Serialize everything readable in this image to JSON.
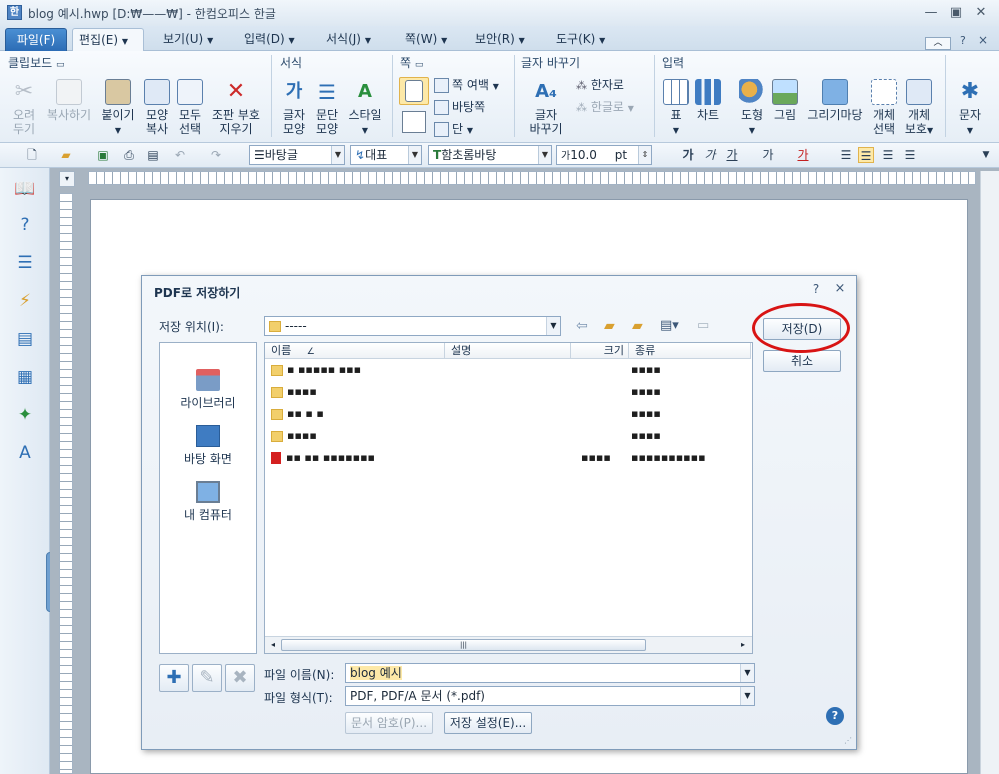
{
  "window": {
    "title": "blog 예시.hwp [D:₩——₩] - 한컴오피스 한글",
    "app_icon": "한"
  },
  "menu": {
    "tabs": [
      "파일(F)",
      "편집(E)",
      "보기(U)",
      "입력(D)",
      "서식(J)",
      "쪽(W)",
      "보안(R)",
      "도구(K)"
    ],
    "right_help": "?",
    "right_close": "×"
  },
  "ribbon": {
    "clipboard": {
      "title": "클립보드",
      "cut": "오려\n두기",
      "copy": "복사하기",
      "paste": "붙이기",
      "format_copy": "모양\n복사",
      "select_all": "모두\n선택",
      "compose": "조판 부호\n지우기"
    },
    "format": {
      "title": "서식",
      "char_shape": "글자\n모양",
      "para_shape": "문단\n모양",
      "style": "스타일"
    },
    "page": {
      "title": "쪽",
      "margin": "쪽 여백",
      "background": "바탕쪽",
      "columns": "단"
    },
    "convert": {
      "title": "글자 바꾸기",
      "change": "글자\n바꾸기",
      "to_hanja": "한자로",
      "to_hangul": "한글로"
    },
    "insert": {
      "title": "입력",
      "table": "표",
      "chart": "차트",
      "shape": "도형",
      "picture": "그림",
      "drawing": "그리기마당",
      "select_obj": "개체\n선택",
      "protect_obj": "개체\n보호",
      "text": "문자"
    }
  },
  "format_bar": {
    "style_name": "바탕글",
    "lang": "대표",
    "font": "함초롬바탕",
    "size": "10.0",
    "unit": "pt",
    "bold": "가",
    "italic": "가",
    "underline": "가",
    "strike": "가",
    "color": "가"
  },
  "dialog": {
    "title": "PDF로 저장하기",
    "help": "?",
    "close": "×",
    "location_label": "저장 위치(I):",
    "location_value": "-----",
    "save_button": "저장(D)",
    "cancel_button": "취소",
    "places": [
      "라이브러리",
      "바탕 화면",
      "내 컴퓨터"
    ],
    "columns": [
      "이름",
      "설명",
      "크기",
      "종류"
    ],
    "files": [
      {
        "type": "folder",
        "name": "▪ ▪▪▪▪▪ ▪▪▪",
        "kind": "▪▪▪▪"
      },
      {
        "type": "folder",
        "name": "▪▪▪▪",
        "kind": "▪▪▪▪"
      },
      {
        "type": "folder",
        "name": "▪▪ ▪ ▪",
        "kind": "▪▪▪▪"
      },
      {
        "type": "folder",
        "name": "▪▪▪▪",
        "kind": "▪▪▪▪"
      },
      {
        "type": "pdf",
        "name": "▪▪ ▪▪ ▪▪▪▪▪▪▪",
        "size": "▪▪▪▪",
        "kind": "▪▪▪▪▪▪▪▪▪▪"
      }
    ],
    "filename_label": "파일 이름(N):",
    "filename_value": "blog 예시",
    "filetype_label": "파일 형식(T):",
    "filetype_value": "PDF, PDF/A 문서 (*.pdf)",
    "password_button": "문서 암호(P)...",
    "settings_button": "저장 설정(E)..."
  }
}
